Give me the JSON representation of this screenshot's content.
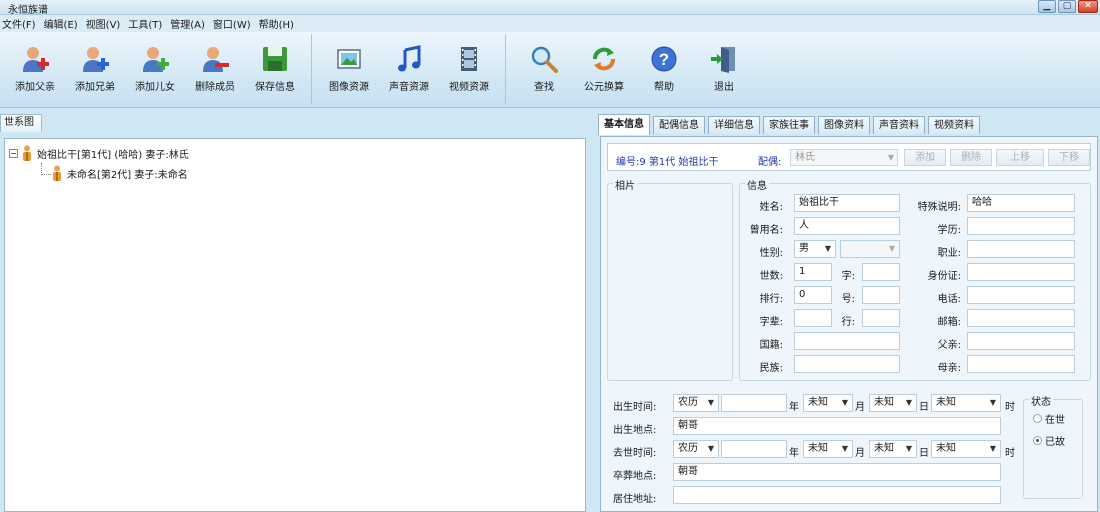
{
  "window": {
    "title": "永恒族谱",
    "min": "▁",
    "max": "▢",
    "close": "✕"
  },
  "menu": [
    "文件(F)",
    "编辑(E)",
    "视图(V)",
    "工具(T)",
    "管理(A)",
    "窗口(W)",
    "帮助(H)"
  ],
  "toolbar": {
    "add_father": "添加父亲",
    "add_sibling": "添加兄弟",
    "add_child": "添加儿女",
    "delete_member": "删除成员",
    "save_info": "保存信息",
    "image_res": "图像资源",
    "audio_res": "声音资源",
    "video_res": "视频资源",
    "search": "查找",
    "year_convert": "公元换算",
    "help": "帮助",
    "exit": "退出"
  },
  "left_panel": {
    "tab": "世系图",
    "tree": [
      {
        "expander": "−",
        "text": "始祖比干[第1代] (哈哈) 妻子:林氏"
      },
      {
        "text": "未命名[第2代] 妻子:未命名"
      }
    ]
  },
  "right_panel": {
    "tabs": [
      "基本信息",
      "配偶信息",
      "详细信息",
      "家族往事",
      "图像资料",
      "声音资料",
      "视频资料"
    ],
    "id_text": "编号:9 第1代 始祖比干",
    "spouse_label": "配偶:",
    "spouse_value": "林氏",
    "dropdown_arrow": "▼",
    "buttons": {
      "add": "添加",
      "delete": "删除",
      "up": "上移",
      "down": "下移"
    },
    "photo_label": "相片",
    "info_label": "信息",
    "fields": {
      "name_label": "姓名:",
      "name": "始祖比干",
      "special_label": "特殊说明:",
      "special": "哈哈",
      "former_label": "曾用名:",
      "former": "人",
      "edu_label": "学历:",
      "edu": "",
      "gender_label": "性别:",
      "gender": "男",
      "job_label": "职业:",
      "job": "",
      "gen_label": "世数:",
      "gen": "1",
      "zi_label": "字:",
      "zi": "",
      "idcard_label": "身份证:",
      "idcard": "",
      "rank_label": "排行:",
      "rank": "0",
      "hao_label": "号:",
      "hao": "",
      "phone_label": "电话:",
      "phone": "",
      "zibei_label": "字辈:",
      "zibei": "",
      "hang_label": "行:",
      "hang": "",
      "email_label": "邮箱:",
      "email": "",
      "nation_label": "国籍:",
      "nation": "",
      "father_label": "父亲:",
      "father": "",
      "ethnic_label": "民族:",
      "ethnic": "",
      "mother_label": "母亲:",
      "mother": ""
    },
    "birth": {
      "label": "出生时间:",
      "calendar": "农历",
      "year": "",
      "year_unit": "年",
      "month": "未知",
      "month_unit": "月",
      "day": "未知",
      "day_unit": "日",
      "hour": "未知",
      "hour_unit": "时"
    },
    "birthplace_label": "出生地点:",
    "birthplace": "朝哥",
    "death": {
      "label": "去世时间:",
      "calendar": "农历",
      "year": "",
      "year_unit": "年",
      "month": "未知",
      "month_unit": "月",
      "day": "未知",
      "day_unit": "日",
      "hour": "未知",
      "hour_unit": "时"
    },
    "burial_label": "卒葬地点:",
    "burial": "朝哥",
    "residence_label": "居住地址:",
    "residence": "",
    "status": {
      "label": "状态",
      "alive": "在世",
      "dead": "已故",
      "selected": "dead"
    }
  }
}
